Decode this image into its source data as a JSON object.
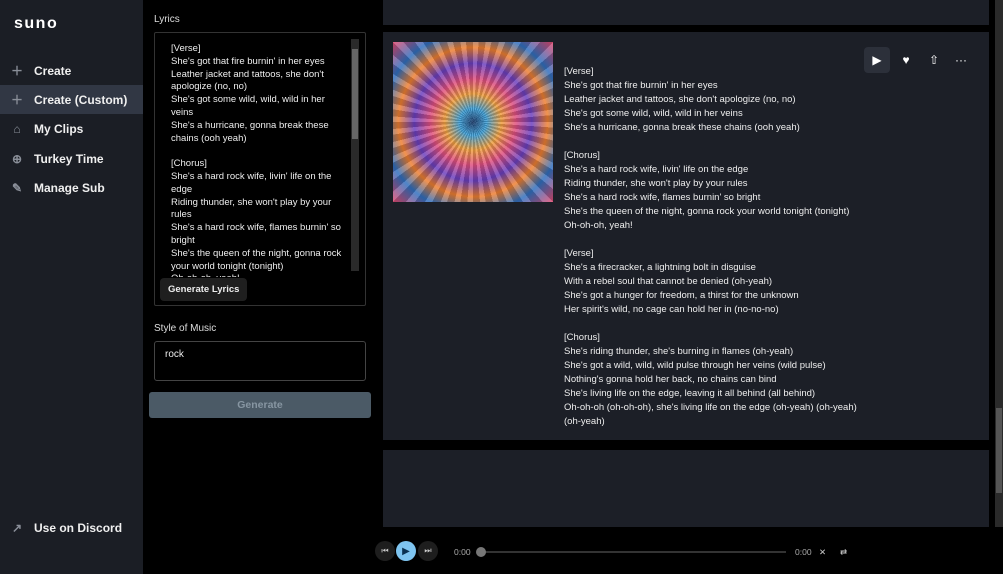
{
  "sidebar": {
    "logo": "suno",
    "items": [
      {
        "label": "Create",
        "icon": "plus-icon",
        "active": false
      },
      {
        "label": "Create (Custom)",
        "icon": "plus-icon",
        "active": true
      },
      {
        "label": "My Clips",
        "icon": "home-icon",
        "active": false
      },
      {
        "label": "Turkey Time",
        "icon": "globe-icon",
        "active": false
      },
      {
        "label": "Manage Sub",
        "icon": "edit-icon",
        "active": false
      }
    ],
    "discord": "Use on Discord"
  },
  "form": {
    "lyrics_label": "Lyrics",
    "lyrics_value": "[Verse]\nShe's got that fire burnin' in her eyes\nLeather jacket and tattoos, she don't apologize (no, no)\nShe's got some wild, wild, wild in her veins\nShe's a hurricane, gonna break these chains (ooh yeah)\n\n[Chorus]\nShe's a hard rock wife, livin' life on the edge\nRiding thunder, she won't play by your rules\nShe's a hard rock wife, flames burnin' so bright\nShe's the queen of the night, gonna rock your world tonight (tonight)\nOh-oh-oh, yeah!",
    "generate_lyrics": "Generate Lyrics",
    "style_label": "Style of Music",
    "style_value": "rock",
    "generate": "Generate"
  },
  "song": {
    "lyrics": "[Verse]\nShe's got that fire burnin' in her eyes\nLeather jacket and tattoos, she don't apologize (no, no)\nShe's got some wild, wild, wild in her veins\nShe's a hurricane, gonna break these chains (ooh yeah)\n\n[Chorus]\nShe's a hard rock wife, livin' life on the edge\nRiding thunder, she won't play by your rules\nShe's a hard rock wife, flames burnin' so bright\nShe's the queen of the night, gonna rock your world tonight (tonight)\nOh-oh-oh, yeah!\n\n[Verse]\nShe's a firecracker, a lightning bolt in disguise\nWith a rebel soul that cannot be denied (oh-yeah)\nShe's got a hunger for freedom, a thirst for the unknown\nHer spirit's wild, no cage can hold her in (no-no-no)\n\n[Chorus]\nShe's riding thunder, she's burning in flames (oh-yeah)\nShe's got a wild, wild, wild pulse through her veins (wild pulse)\nNothing's gonna hold her back, no chains can bind\nShe's living life on the edge, leaving it all behind (all behind)\nOh-oh-oh (oh-oh-oh), she's living life on the edge (oh-yeah) (oh-yeah)\n(oh-yeah)"
  },
  "player": {
    "current": "0:00",
    "duration": "0:00",
    "progress": 0
  }
}
